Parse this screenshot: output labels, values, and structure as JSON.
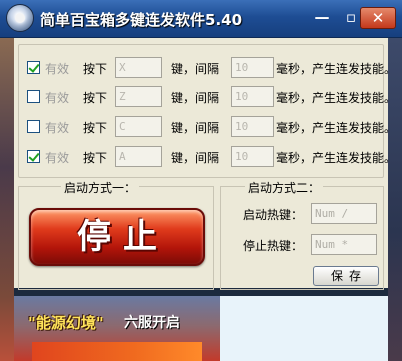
{
  "window": {
    "title": "简单百宝箱多键连发软件5.40",
    "minimize_glyph": "—",
    "maximize_glyph": "▫",
    "close_glyph": "✕"
  },
  "rows": [
    {
      "enabled_label": "有效",
      "checked": true,
      "press_label": "按下",
      "key_value": "X",
      "interval_label": "键，间隔",
      "ms_value": "10",
      "desc": "毫秒，产生连发技能。"
    },
    {
      "enabled_label": "有效",
      "checked": false,
      "press_label": "按下",
      "key_value": "Z",
      "interval_label": "键，间隔",
      "ms_value": "10",
      "desc": "毫秒，产生连发技能。"
    },
    {
      "enabled_label": "有效",
      "checked": false,
      "press_label": "按下",
      "key_value": "C",
      "interval_label": "键，间隔",
      "ms_value": "10",
      "desc": "毫秒，产生连发技能。"
    },
    {
      "enabled_label": "有效",
      "checked": true,
      "press_label": "按下",
      "key_value": "A",
      "interval_label": "键，间隔",
      "ms_value": "10",
      "desc": "毫秒，产生连发技能。"
    }
  ],
  "mode1": {
    "legend": "启动方式一：",
    "stop_label": "停止"
  },
  "mode2": {
    "legend": "启动方式二：",
    "start_hotkey_label": "启动热键：",
    "start_hotkey_value": "Num /",
    "stop_hotkey_label": "停止热键：",
    "stop_hotkey_value": "Num *",
    "save_label": "保存"
  },
  "banner": {
    "game_name": "\"能源幻境\"",
    "open_text": "六服开启"
  },
  "colors": {
    "titlebar": "#1e4d94",
    "stop_button": "#c4200f",
    "form_bg": "#ece9d8"
  }
}
